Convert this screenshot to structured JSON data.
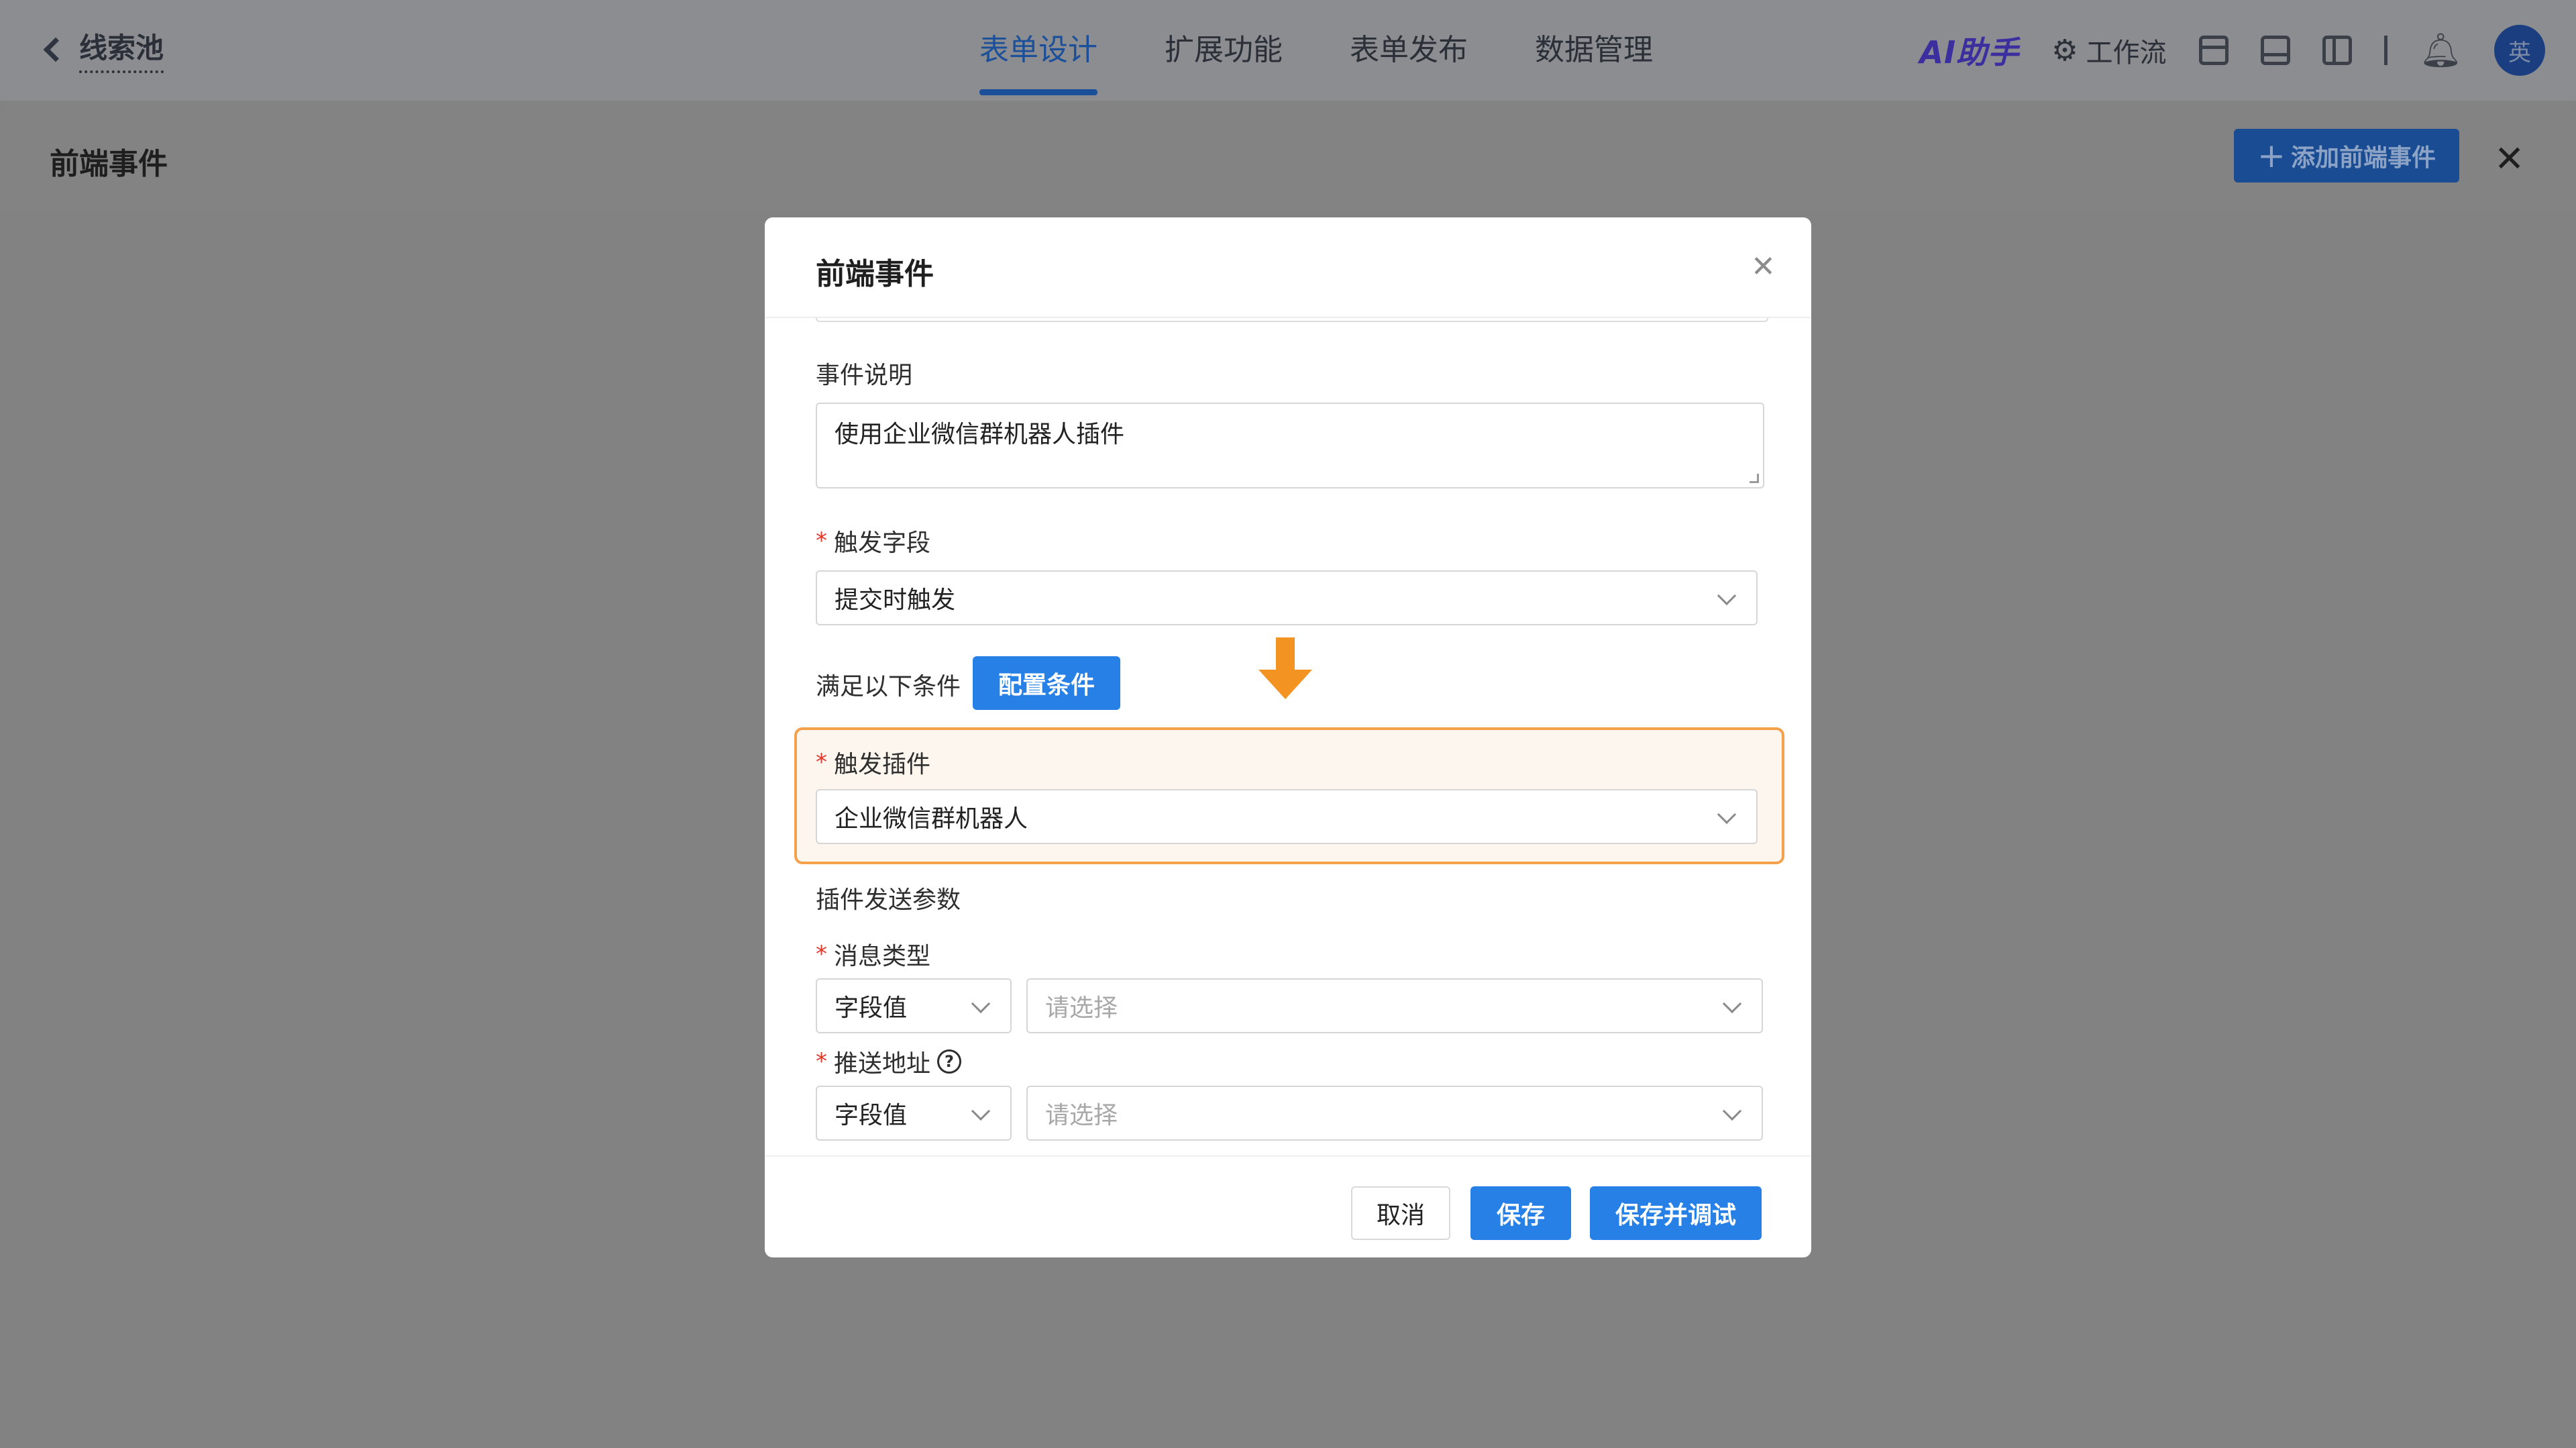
{
  "topbar": {
    "back_title": "线索池",
    "tabs": [
      "表单设计",
      "扩展功能",
      "表单发布",
      "数据管理"
    ],
    "active_tab": "表单设计",
    "ai_helper": "AI助手",
    "workflow": "工作流",
    "avatar_text": "英"
  },
  "drawer": {
    "title": "前端事件",
    "add_button": "添加前端事件"
  },
  "dialog": {
    "title": "前端事件",
    "event_desc_label": "事件说明",
    "event_desc_value": "使用企业微信群机器人插件",
    "trigger_field_label": "触发字段",
    "trigger_field_value": "提交时触发",
    "condition_label": "满足以下条件",
    "config_condition_button": "配置条件",
    "trigger_plugin_label": "触发插件",
    "trigger_plugin_value": "企业微信群机器人",
    "plugin_params_label": "插件发送参数",
    "msg_type_label": "消息类型",
    "msg_type_source": "字段值",
    "msg_type_placeholder": "请选择",
    "push_url_label": "推送地址",
    "push_url_source": "字段值",
    "push_url_placeholder": "请选择",
    "cancel_button": "取消",
    "save_button": "保存",
    "save_debug_button": "保存并调试"
  },
  "colors": {
    "primary": "#2680e6",
    "highlight_border": "#f5a04a",
    "arrow": "#f39322",
    "required": "#e5362a"
  }
}
